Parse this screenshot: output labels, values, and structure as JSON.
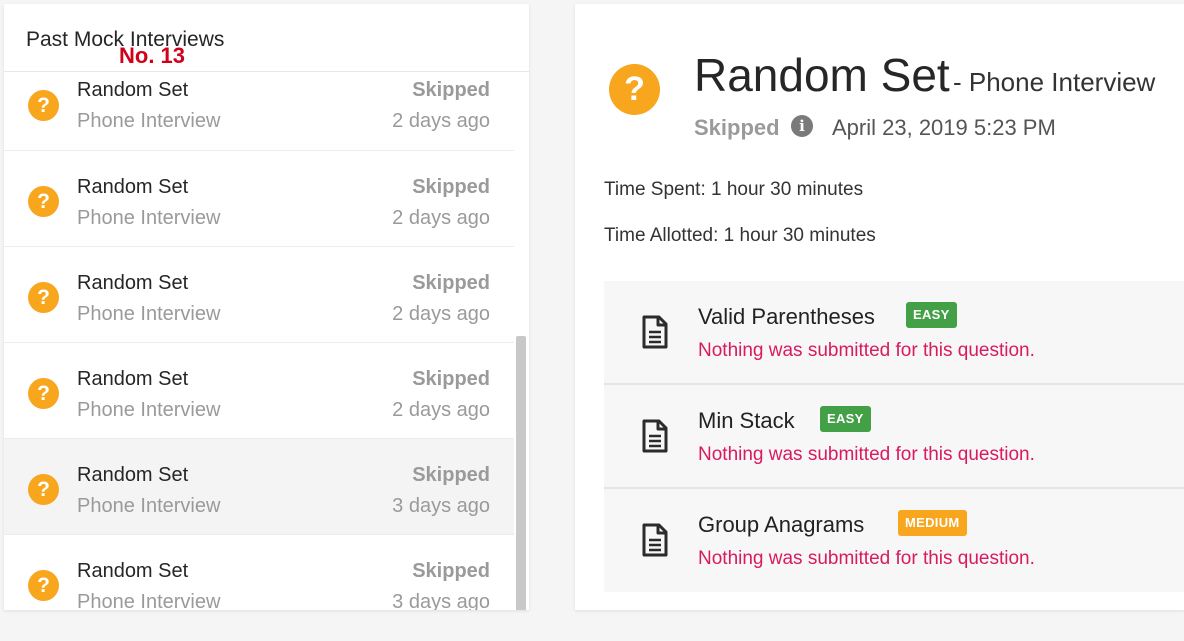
{
  "sidebar": {
    "title": "Past Mock Interviews",
    "overlay_label": "No. 13",
    "icon_name": "question-circle-icon",
    "items": [
      {
        "name": "Random Set",
        "type": "Phone Interview",
        "status": "Skipped",
        "time": "2 days ago",
        "active": false
      },
      {
        "name": "Random Set",
        "type": "Phone Interview",
        "status": "Skipped",
        "time": "2 days ago",
        "active": false
      },
      {
        "name": "Random Set",
        "type": "Phone Interview",
        "status": "Skipped",
        "time": "2 days ago",
        "active": false
      },
      {
        "name": "Random Set",
        "type": "Phone Interview",
        "status": "Skipped",
        "time": "2 days ago",
        "active": false
      },
      {
        "name": "Random Set",
        "type": "Phone Interview",
        "status": "Skipped",
        "time": "3 days ago",
        "active": true
      },
      {
        "name": "Random Set",
        "type": "Phone Interview",
        "status": "Skipped",
        "time": "3 days ago",
        "active": false
      }
    ]
  },
  "detail": {
    "title": "Random Set",
    "subtitle": "- Phone Interview",
    "status": "Skipped",
    "date": "April 23, 2019 5:23 PM",
    "time_spent": "Time Spent: 1 hour 30 minutes",
    "time_allotted": "Time Allotted: 1 hour 30 minutes",
    "questions": [
      {
        "title": "Valid Parentheses",
        "difficulty": "EASY",
        "note": "Nothing was submitted for this question."
      },
      {
        "title": "Min Stack",
        "difficulty": "EASY",
        "note": "Nothing was submitted for this question."
      },
      {
        "title": "Group Anagrams",
        "difficulty": "MEDIUM",
        "note": "Nothing was submitted for this question."
      }
    ]
  },
  "colors": {
    "accent_orange": "#f7a61e",
    "easy_green": "#43a047",
    "note_pink": "#d81b60",
    "muted_gray": "#9a9a9a"
  }
}
